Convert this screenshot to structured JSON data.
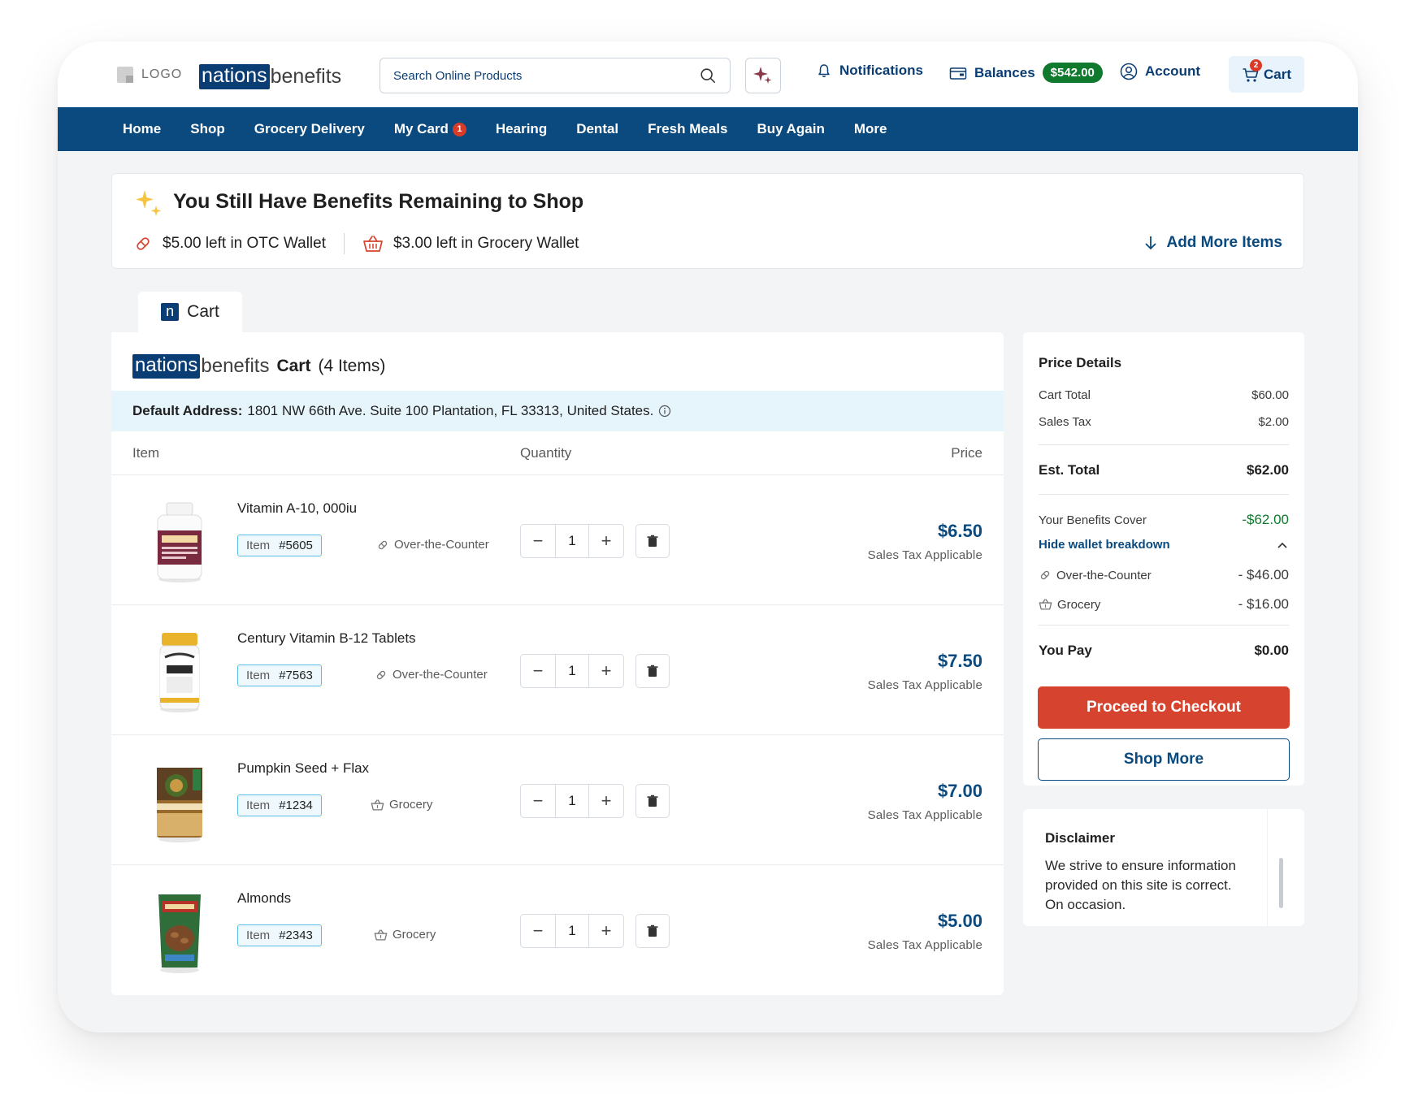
{
  "header": {
    "logo_placeholder": "LOGO",
    "brand_part1": "nations",
    "brand_part2": "benefits",
    "search_placeholder": "Search Online Products",
    "notifications_label": "Notifications",
    "balances_label": "Balances",
    "balances_amount": "$542.00",
    "account_label": "Account",
    "cart_label": "Cart",
    "cart_count": "2"
  },
  "nav": {
    "items": [
      {
        "label": "Home"
      },
      {
        "label": "Shop"
      },
      {
        "label": "Grocery Delivery"
      },
      {
        "label": "My Card",
        "badge": "1"
      },
      {
        "label": "Hearing"
      },
      {
        "label": "Dental"
      },
      {
        "label": "Fresh Meals"
      },
      {
        "label": "Buy Again"
      },
      {
        "label": "More"
      }
    ]
  },
  "banner": {
    "title": "You Still Have Benefits Remaining to Shop",
    "otc_text": "$5.00 left in OTC Wallet",
    "grocery_text": "$3.00 left in Grocery Wallet",
    "add_more_label": "Add More Items"
  },
  "cart": {
    "tab_label": "Cart",
    "title": "Cart",
    "count_text": "(4 Items)",
    "address_label": "Default Address:",
    "address": "1801 NW 66th Ave. Suite 100 Plantation, FL 33313, United States.",
    "col_item": "Item",
    "col_quantity": "Quantity",
    "col_price": "Price",
    "item_prefix": "Item",
    "items": [
      {
        "name": "Vitamin A-10, 000iu",
        "number": "#5605",
        "category": "Over-the-Counter",
        "quantity": "1",
        "price": "$6.50",
        "tax_note": "Sales Tax Applicable"
      },
      {
        "name": "Century Vitamin B-12 Tablets",
        "number": "#7563",
        "category": "Over-the-Counter",
        "quantity": "1",
        "price": "$7.50",
        "tax_note": "Sales Tax Applicable"
      },
      {
        "name": "Pumpkin Seed + Flax",
        "number": "#1234",
        "category": "Grocery",
        "quantity": "1",
        "price": "$7.00",
        "tax_note": "Sales Tax Applicable"
      },
      {
        "name": "Almonds",
        "number": "#2343",
        "category": "Grocery",
        "quantity": "1",
        "price": "$5.00",
        "tax_note": "Sales Tax Applicable"
      }
    ]
  },
  "price_details": {
    "title": "Price Details",
    "cart_total_label": "Cart Total",
    "cart_total": "$60.00",
    "sales_tax_label": "Sales Tax",
    "sales_tax": "$2.00",
    "est_total_label": "Est. Total",
    "est_total": "$62.00",
    "benefits_label": "Your Benefits Cover",
    "benefits_amount": "-$62.00",
    "hide_label": "Hide wallet breakdown",
    "otc_label": "Over-the-Counter",
    "otc_amount": "- $46.00",
    "grocery_label": "Grocery",
    "grocery_amount": "- $16.00",
    "you_pay_label": "You Pay",
    "you_pay": "$0.00",
    "checkout_label": "Proceed to Checkout",
    "shop_more_label": "Shop More"
  },
  "disclaimer": {
    "title": "Disclaimer",
    "text": "We strive to ensure information provided on this site is correct. On occasion."
  },
  "colors": {
    "brand_navy": "#0a4a7e",
    "checkout_red": "#d6432e",
    "balance_green": "#0f7a2d",
    "badge_red": "#d93b28"
  }
}
